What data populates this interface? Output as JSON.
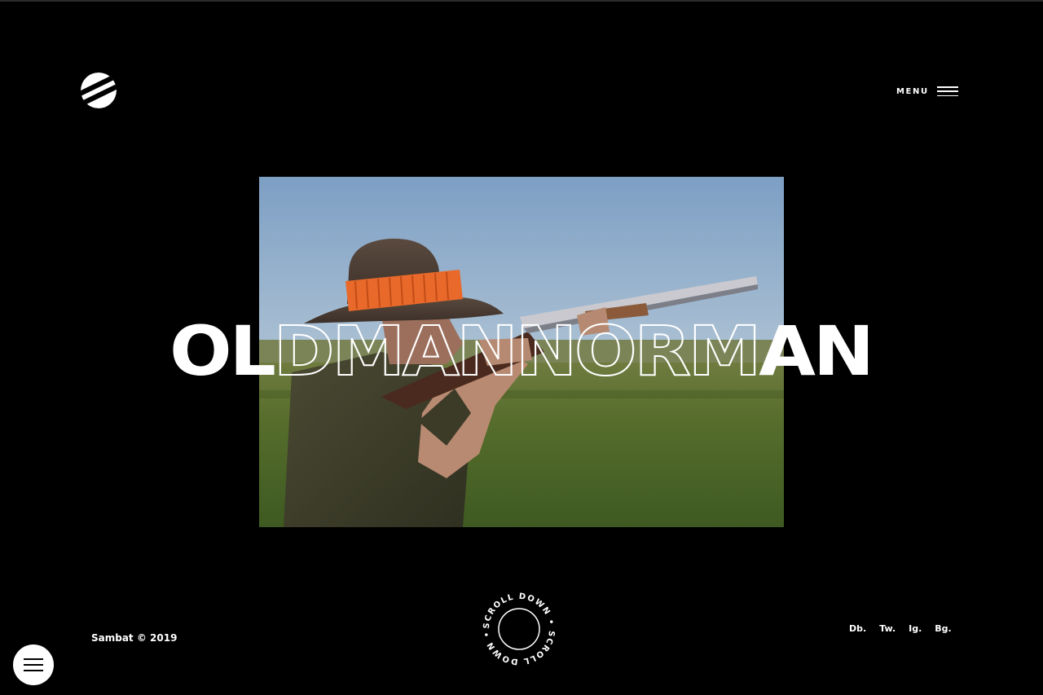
{
  "header": {
    "logo_icon": "striped-circle-logo",
    "menu_label": "MENU",
    "menu_icon": "hamburger-icon"
  },
  "hero": {
    "title_solid_left": "OL",
    "title_outline": "DMANNORM",
    "title_solid_right": "AN",
    "image_icon": "man-with-shotgun-photo"
  },
  "footer": {
    "copyright": "Sambat © 2019",
    "scroll_text": "SCROLL DOWN • SCROLL DOWN • ",
    "social": [
      "Db.",
      "Tw.",
      "Ig.",
      "Bg."
    ],
    "fab_icon": "hamburger-icon"
  },
  "colors": {
    "background": "#000000",
    "text": "#ffffff",
    "accent_orange": "#e8692a"
  }
}
